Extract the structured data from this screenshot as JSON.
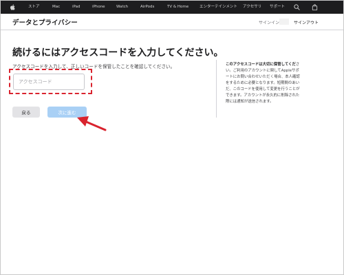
{
  "nav": {
    "items": [
      "ストア",
      "Mac",
      "iPad",
      "iPhone",
      "Watch",
      "AirPods",
      "TV & Home",
      "エンターテインメント",
      "アクセサリ",
      "サポート"
    ],
    "icons": [
      "apple-logo-icon",
      "search-icon",
      "bag-icon"
    ]
  },
  "subheader": {
    "title": "データとプライバシー",
    "signin_label": "サインイン:",
    "signout_label": "サインアウト"
  },
  "main": {
    "heading": "続けるにはアクセスコードを入力してください。",
    "instruction": "アクセスコードを入力して、正しいコードを保管したことを確認してください。",
    "code_placeholder": "アクセスコード",
    "code_value": "",
    "back_label": "戻る",
    "next_label": "次に進む"
  },
  "sidebar": {
    "lines": [
      "このアクセスコードは大切に保管してくださ",
      "い。ご利用のアカウントに関してAppleサポ",
      "ートにお問い合わせいただく場合、本人確認",
      "をするために必要となります。短期間のあい",
      "だ、このコードを使用して変更を行うことが",
      "できます。アカウントが永久的に削除された",
      "際には通知が送信されます。"
    ],
    "bold_chars": 19
  },
  "colors": {
    "nav_bg": "#1d1d1f",
    "highlight": "#d9232e",
    "next_button": "#a9d0f5",
    "back_button": "#e3e3e6"
  }
}
